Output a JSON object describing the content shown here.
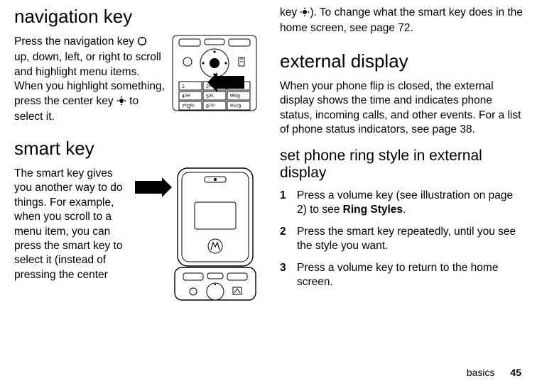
{
  "col1": {
    "h_nav": "navigation key",
    "p_nav_a": "Press the navigation key ",
    "p_nav_b": " up, down, left, or right to scroll and highlight menu items. When you highlight something, press the center key ",
    "p_nav_c": " to select it.",
    "h_smart": "smart key",
    "p_smart": "The smart key gives you another way to do things. For example, when you scroll to a menu item, you can press the smart key to select it (instead of pressing the center"
  },
  "col2": {
    "p_cont_a": "key ",
    "p_cont_b": "). To change what the smart key does in the home screen, see page 72.",
    "h_ext": "external display",
    "p_ext": "When your phone flip is closed, the external display shows the time and indicates phone status, incoming calls, and other events. For a list of phone status indicators, see page 38.",
    "h_ring": "set phone ring style in external display",
    "steps": [
      {
        "a": "Press a volume key (see illustration on page 2) to see ",
        "b": "Ring Styles",
        "c": "."
      },
      {
        "a": "Press the smart key repeatedly, until you see the style you want.",
        "b": "",
        "c": ""
      },
      {
        "a": "Press a volume key to return to the home screen.",
        "b": "",
        "c": ""
      }
    ]
  },
  "footer": {
    "label": "basics",
    "page": "45"
  }
}
